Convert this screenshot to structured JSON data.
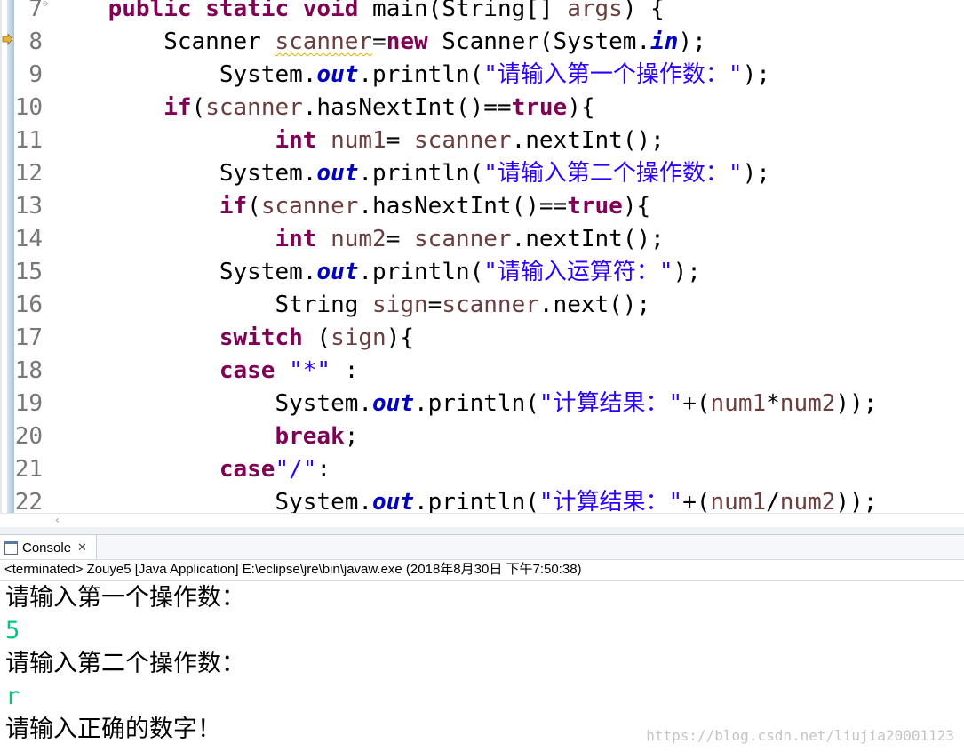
{
  "editor": {
    "lines": [
      {
        "num": "7",
        "fold": true,
        "parts": [
          [
            "p",
            "    "
          ],
          [
            "kw",
            "public"
          ],
          [
            "p",
            " "
          ],
          [
            "kw",
            "static"
          ],
          [
            "p",
            " "
          ],
          [
            "kw",
            "void"
          ],
          [
            "p",
            " main(String[] "
          ],
          [
            "var",
            "args"
          ],
          [
            "p",
            ") {"
          ]
        ]
      },
      {
        "num": "8",
        "parts": [
          [
            "p",
            "        Scanner "
          ],
          [
            "varw",
            "scanner"
          ],
          [
            "p",
            "="
          ],
          [
            "kw",
            "new"
          ],
          [
            "p",
            " Scanner(System."
          ],
          [
            "fld",
            "in"
          ],
          [
            "p",
            ");"
          ]
        ]
      },
      {
        "num": "9",
        "parts": [
          [
            "p",
            "            System."
          ],
          [
            "fld",
            "out"
          ],
          [
            "p",
            ".println("
          ],
          [
            "str",
            "\"请输入第一个操作数：\""
          ],
          [
            "p",
            ");"
          ]
        ]
      },
      {
        "num": "10",
        "parts": [
          [
            "p",
            "        "
          ],
          [
            "kw",
            "if"
          ],
          [
            "p",
            "("
          ],
          [
            "var",
            "scanner"
          ],
          [
            "p",
            ".hasNextInt()=="
          ],
          [
            "kw",
            "true"
          ],
          [
            "p",
            "){"
          ]
        ]
      },
      {
        "num": "11",
        "parts": [
          [
            "p",
            "                "
          ],
          [
            "kw",
            "int"
          ],
          [
            "p",
            " "
          ],
          [
            "var",
            "num1"
          ],
          [
            "p",
            "= "
          ],
          [
            "var",
            "scanner"
          ],
          [
            "p",
            ".nextInt();"
          ]
        ]
      },
      {
        "num": "12",
        "parts": [
          [
            "p",
            "            System."
          ],
          [
            "fld",
            "out"
          ],
          [
            "p",
            ".println("
          ],
          [
            "str",
            "\"请输入第二个操作数：\""
          ],
          [
            "p",
            ");"
          ]
        ]
      },
      {
        "num": "13",
        "parts": [
          [
            "p",
            "            "
          ],
          [
            "kw",
            "if"
          ],
          [
            "p",
            "("
          ],
          [
            "var",
            "scanner"
          ],
          [
            "p",
            ".hasNextInt()=="
          ],
          [
            "kw",
            "true"
          ],
          [
            "p",
            "){"
          ]
        ]
      },
      {
        "num": "14",
        "parts": [
          [
            "p",
            "                "
          ],
          [
            "kw",
            "int"
          ],
          [
            "p",
            " "
          ],
          [
            "var",
            "num2"
          ],
          [
            "p",
            "= "
          ],
          [
            "var",
            "scanner"
          ],
          [
            "p",
            ".nextInt();"
          ]
        ]
      },
      {
        "num": "15",
        "parts": [
          [
            "p",
            "            System."
          ],
          [
            "fld",
            "out"
          ],
          [
            "p",
            ".println("
          ],
          [
            "str",
            "\"请输入运算符：\""
          ],
          [
            "p",
            ");"
          ]
        ]
      },
      {
        "num": "16",
        "parts": [
          [
            "p",
            "                String "
          ],
          [
            "var",
            "sign"
          ],
          [
            "p",
            "="
          ],
          [
            "var",
            "scanner"
          ],
          [
            "p",
            ".next();"
          ]
        ]
      },
      {
        "num": "17",
        "parts": [
          [
            "p",
            "            "
          ],
          [
            "kw",
            "switch"
          ],
          [
            "p",
            " ("
          ],
          [
            "var",
            "sign"
          ],
          [
            "p",
            "){"
          ]
        ]
      },
      {
        "num": "18",
        "parts": [
          [
            "p",
            "            "
          ],
          [
            "kw",
            "case"
          ],
          [
            "p",
            " "
          ],
          [
            "str",
            "\"*\""
          ],
          [
            "p",
            " :"
          ]
        ]
      },
      {
        "num": "19",
        "parts": [
          [
            "p",
            "                System."
          ],
          [
            "fld",
            "out"
          ],
          [
            "p",
            ".println("
          ],
          [
            "str",
            "\"计算结果：\""
          ],
          [
            "p",
            "+("
          ],
          [
            "var",
            "num1"
          ],
          [
            "p",
            "*"
          ],
          [
            "var",
            "num2"
          ],
          [
            "p",
            "));"
          ]
        ]
      },
      {
        "num": "20",
        "parts": [
          [
            "p",
            "                "
          ],
          [
            "kw",
            "break"
          ],
          [
            "p",
            ";"
          ]
        ]
      },
      {
        "num": "21",
        "parts": [
          [
            "p",
            "            "
          ],
          [
            "kw",
            "case"
          ],
          [
            "str",
            "\"/\""
          ],
          [
            "p",
            ":"
          ]
        ]
      },
      {
        "num": "22",
        "parts": [
          [
            "p",
            "                System."
          ],
          [
            "fld",
            "out"
          ],
          [
            "p",
            ".println("
          ],
          [
            "str",
            "\"计算结果：\""
          ],
          [
            "p",
            "+("
          ],
          [
            "var",
            "num1"
          ],
          [
            "p",
            "/"
          ],
          [
            "var",
            "num2"
          ],
          [
            "p",
            "));"
          ]
        ]
      }
    ]
  },
  "console": {
    "tab_label": "Console",
    "status": "<terminated> Zouye5 [Java Application] E:\\eclipse\\jre\\bin\\javaw.exe (2018年8月30日 下午7:50:38)",
    "output": [
      {
        "text": "请输入第一个操作数：",
        "kind": "plain"
      },
      {
        "text": "5",
        "kind": "input"
      },
      {
        "text": "请输入第二个操作数：",
        "kind": "plain"
      },
      {
        "text": "r",
        "kind": "input"
      },
      {
        "text": "请输入正确的数字！",
        "kind": "plain"
      }
    ]
  },
  "watermark": "https://blog.csdn.net/liujia20001123",
  "colors": {
    "keyword": "#7f0055",
    "string": "#2a00ff",
    "static_field": "#0000c0",
    "local_variable": "#6a3e3e",
    "console_input": "#00c87d",
    "line_number": "#777777"
  },
  "icons": {
    "fold": "fold-collapse-icon",
    "bookmark": "quick-fix-warning-icon",
    "console": "console-icon",
    "close": "close-icon",
    "scroll_left": "scroll-left-arrow-icon"
  }
}
